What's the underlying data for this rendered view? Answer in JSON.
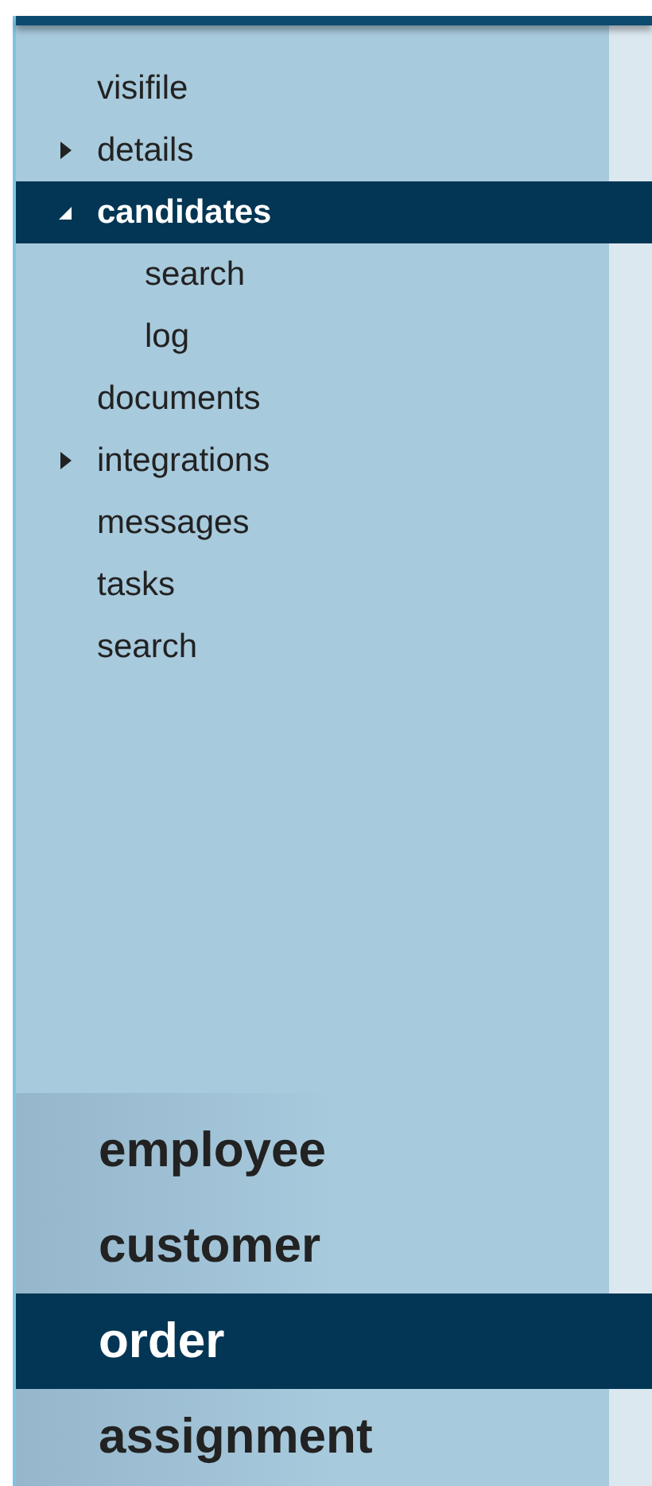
{
  "navigation": [
    {
      "label": "visifile",
      "kind": "leaf",
      "selected": false
    },
    {
      "label": "details",
      "kind": "group",
      "expanded": false,
      "selected": false
    },
    {
      "label": "candidates",
      "kind": "group",
      "expanded": true,
      "selected": true,
      "children": [
        {
          "label": "search",
          "selected": false
        },
        {
          "label": "log",
          "selected": false
        }
      ]
    },
    {
      "label": "documents",
      "kind": "leaf",
      "selected": false
    },
    {
      "label": "integrations",
      "kind": "group",
      "expanded": false,
      "selected": false
    },
    {
      "label": "messages",
      "kind": "leaf",
      "selected": false
    },
    {
      "label": "tasks",
      "kind": "leaf",
      "selected": false
    },
    {
      "label": "search",
      "kind": "leaf",
      "selected": false
    }
  ],
  "modules": [
    {
      "label": "employee",
      "selected": false
    },
    {
      "label": "customer",
      "selected": false
    },
    {
      "label": "order",
      "selected": true
    },
    {
      "label": "assignment",
      "selected": false
    }
  ]
}
